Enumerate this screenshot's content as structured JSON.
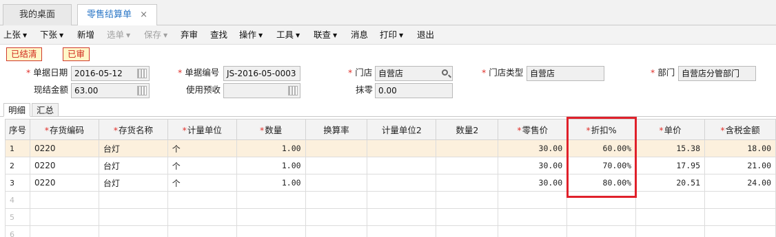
{
  "tabs": [
    {
      "label": "我的桌面",
      "active": false
    },
    {
      "label": "零售结算单",
      "active": true,
      "close": "×"
    }
  ],
  "toolbar": {
    "up": "上张",
    "down": "下张",
    "new": "新增",
    "select": "选单",
    "save": "保存",
    "abandon": "弃审",
    "find": "查找",
    "operate": "操作",
    "tools": "工具",
    "linkquery": "联查",
    "message": "消息",
    "print": "打印",
    "exit": "退出",
    "caret": "▼"
  },
  "status": {
    "settled": "已结清",
    "audited": "已审"
  },
  "form": {
    "doc_date_label": "单据日期",
    "doc_date": "2016-05-12",
    "doc_no_label": "单据编号",
    "doc_no": "JS-2016-05-0003",
    "store_label": "门店",
    "store": "自营店",
    "store_type_label": "门店类型",
    "store_type": "自营店",
    "dept_label": "部门",
    "dept": "自营店分管部门",
    "cash_label": "现结金额",
    "cash": "63.00",
    "prepay_label": "使用预收",
    "prepay": "",
    "rounding_label": "抹零",
    "rounding": "0.00",
    "required_mark": "*"
  },
  "subtabs": {
    "detail": "明细",
    "summary": "汇总"
  },
  "grid": {
    "headers": {
      "idx": "序号",
      "code": "存货编码",
      "name": "存货名称",
      "unit": "计量单位",
      "qty": "数量",
      "rate": "换算率",
      "unit2": "计量单位2",
      "qty2": "数量2",
      "retail": "零售价",
      "discount": "折扣%",
      "price": "单价",
      "amount": "含税金额"
    },
    "rows": [
      {
        "idx": "1",
        "code": "0220",
        "name": "台灯",
        "unit": "个",
        "qty": "1.00",
        "retail": "30.00",
        "discount": "60.00%",
        "price": "15.38",
        "amount": "18.00"
      },
      {
        "idx": "2",
        "code": "0220",
        "name": "台灯",
        "unit": "个",
        "qty": "1.00",
        "retail": "30.00",
        "discount": "70.00%",
        "price": "17.95",
        "amount": "21.00"
      },
      {
        "idx": "3",
        "code": "0220",
        "name": "台灯",
        "unit": "个",
        "qty": "1.00",
        "retail": "30.00",
        "discount": "80.00%",
        "price": "20.51",
        "amount": "24.00"
      }
    ],
    "empty_rows": [
      "4",
      "5",
      "6"
    ]
  }
}
